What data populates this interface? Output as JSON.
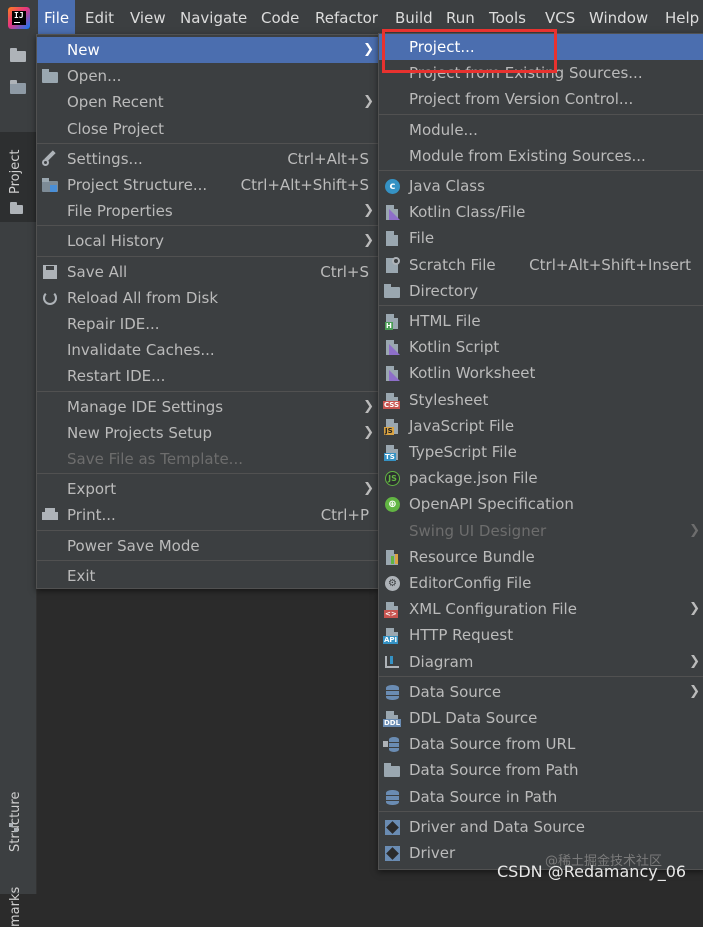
{
  "menubar": {
    "items": [
      "File",
      "Edit",
      "View",
      "Navigate",
      "Code",
      "Refactor",
      "Build",
      "Run",
      "Tools",
      "VCS",
      "Window",
      "Help"
    ]
  },
  "toolstrip": {
    "project_tab": "Project",
    "structure_tab": "Structure",
    "bookmarks_tab": "marks"
  },
  "file_menu": [
    {
      "label": "New",
      "submenu": true,
      "selected": true
    },
    {
      "label": "Open...",
      "icon": "open-folder-icon"
    },
    {
      "label": "Open Recent",
      "submenu": true
    },
    {
      "label": "Close Project"
    },
    {
      "sep": true
    },
    {
      "label": "Settings...",
      "shortcut": "Ctrl+Alt+S",
      "icon": "wrench-icon"
    },
    {
      "label": "Project Structure...",
      "shortcut": "Ctrl+Alt+Shift+S",
      "icon": "project-structure-icon"
    },
    {
      "label": "File Properties",
      "submenu": true
    },
    {
      "sep": true
    },
    {
      "label": "Local History",
      "submenu": true
    },
    {
      "sep": true
    },
    {
      "label": "Save All",
      "shortcut": "Ctrl+S",
      "icon": "save-icon"
    },
    {
      "label": "Reload All from Disk",
      "icon": "reload-icon"
    },
    {
      "label": "Repair IDE..."
    },
    {
      "label": "Invalidate Caches..."
    },
    {
      "label": "Restart IDE..."
    },
    {
      "sep": true
    },
    {
      "label": "Manage IDE Settings",
      "submenu": true
    },
    {
      "label": "New Projects Setup",
      "submenu": true
    },
    {
      "label": "Save File as Template...",
      "disabled": true
    },
    {
      "sep": true
    },
    {
      "label": "Export",
      "submenu": true
    },
    {
      "label": "Print...",
      "shortcut": "Ctrl+P",
      "icon": "print-icon"
    },
    {
      "sep": true
    },
    {
      "label": "Power Save Mode"
    },
    {
      "sep": true
    },
    {
      "label": "Exit"
    }
  ],
  "new_menu": [
    {
      "label": "Project...",
      "selected": true
    },
    {
      "label": "Project from Existing Sources..."
    },
    {
      "label": "Project from Version Control..."
    },
    {
      "sep": true
    },
    {
      "label": "Module..."
    },
    {
      "label": "Module from Existing Sources..."
    },
    {
      "sep": true
    },
    {
      "label": "Java Class",
      "icon": "java-class-icon"
    },
    {
      "label": "Kotlin Class/File",
      "icon": "kotlin-class-icon"
    },
    {
      "label": "File",
      "icon": "file-icon"
    },
    {
      "label": "Scratch File",
      "shortcut": "Ctrl+Alt+Shift+Insert",
      "icon": "scratch-file-icon"
    },
    {
      "label": "Directory",
      "icon": "folder-icon"
    },
    {
      "sep": true
    },
    {
      "label": "HTML File",
      "icon": "html-file-icon"
    },
    {
      "label": "Kotlin Script",
      "icon": "kotlin-script-icon"
    },
    {
      "label": "Kotlin Worksheet",
      "icon": "kotlin-worksheet-icon"
    },
    {
      "label": "Stylesheet",
      "icon": "css-file-icon"
    },
    {
      "label": "JavaScript File",
      "icon": "js-file-icon"
    },
    {
      "label": "TypeScript File",
      "icon": "ts-file-icon"
    },
    {
      "label": "package.json File",
      "icon": "nodejs-icon"
    },
    {
      "label": "OpenAPI Specification",
      "icon": "openapi-icon"
    },
    {
      "label": "Swing UI Designer",
      "submenu": true,
      "disabled": true
    },
    {
      "label": "Resource Bundle",
      "icon": "resource-bundle-icon"
    },
    {
      "label": "EditorConfig File",
      "icon": "editorconfig-icon"
    },
    {
      "label": "XML Configuration File",
      "submenu": true,
      "icon": "xml-file-icon"
    },
    {
      "label": "HTTP Request",
      "icon": "http-request-icon"
    },
    {
      "label": "Diagram",
      "submenu": true,
      "icon": "diagram-icon"
    },
    {
      "sep": true
    },
    {
      "label": "Data Source",
      "submenu": true,
      "icon": "database-icon"
    },
    {
      "label": "DDL Data Source",
      "icon": "ddl-icon"
    },
    {
      "label": "Data Source from URL",
      "icon": "datasource-url-icon"
    },
    {
      "label": "Data Source from Path",
      "icon": "datasource-path-icon"
    },
    {
      "label": "Data Source in Path",
      "icon": "database-icon"
    },
    {
      "sep": true
    },
    {
      "label": "Driver and Data Source",
      "icon": "driver-icon"
    },
    {
      "label": "Driver",
      "icon": "driver-icon"
    }
  ],
  "watermark": {
    "main": "CSDN @Redamancy_06",
    "secondary": "@稀土掘金技术社区"
  }
}
